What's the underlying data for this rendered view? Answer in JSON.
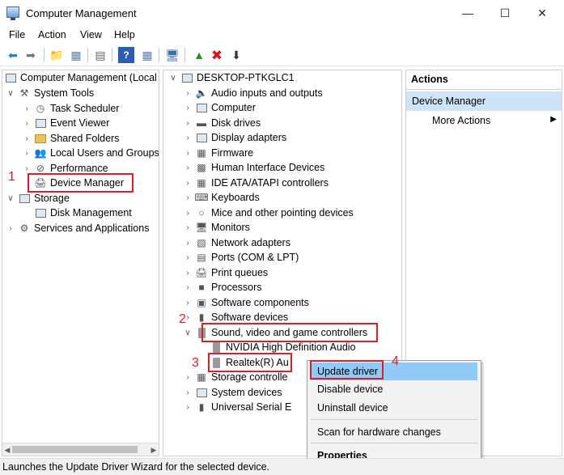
{
  "window": {
    "title": "Computer Management",
    "minimize_icon": "minimize-icon",
    "maximize_icon": "maximize-icon",
    "close_icon": "close-icon"
  },
  "menu": [
    "File",
    "Action",
    "View",
    "Help"
  ],
  "toolbar": [
    "back-arrow-icon",
    "forward-arrow-icon",
    "up-folder-icon",
    "show-hide-tree-icon",
    "export-list-icon",
    "help-icon",
    "show-pane-icon",
    "monitor-icon",
    "add-driver-icon",
    "delete-x-icon",
    "download-icon"
  ],
  "left_tree": {
    "root": "Computer Management (Local",
    "system_tools": "System Tools",
    "task_scheduler": "Task Scheduler",
    "event_viewer": "Event Viewer",
    "shared_folders": "Shared Folders",
    "local_users": "Local Users and Groups",
    "performance": "Performance",
    "device_manager": "Device Manager",
    "storage": "Storage",
    "disk_management": "Disk Management",
    "services_apps": "Services and Applications"
  },
  "device_tree": {
    "root": "DESKTOP-PTKGLC1",
    "categories": [
      "Audio inputs and outputs",
      "Computer",
      "Disk drives",
      "Display adapters",
      "Firmware",
      "Human Interface Devices",
      "IDE ATA/ATAPI controllers",
      "Keyboards",
      "Mice and other pointing devices",
      "Monitors",
      "Network adapters",
      "Ports (COM & LPT)",
      "Print queues",
      "Processors",
      "Software components",
      "Software devices"
    ],
    "sound_category": "Sound, video and game controllers",
    "sound_children": [
      "NVIDIA High Definition Audio",
      "Realtek(R) Au"
    ],
    "after": [
      "Storage controlle",
      "System devices",
      "Universal Serial E"
    ]
  },
  "actions": {
    "header": "Actions",
    "section": "Device Manager",
    "more": "More Actions"
  },
  "context_menu": {
    "update": "Update driver",
    "disable": "Disable device",
    "uninstall": "Uninstall device",
    "scan": "Scan for hardware changes",
    "properties": "Properties"
  },
  "annotations": [
    "1",
    "2",
    "3",
    "4"
  ],
  "status": "Launches the Update Driver Wizard for the selected device."
}
